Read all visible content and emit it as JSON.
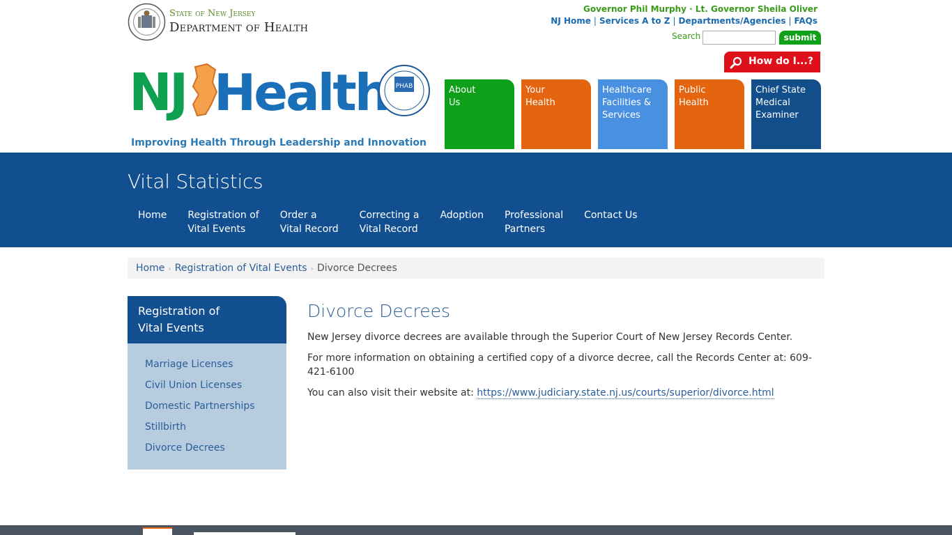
{
  "header": {
    "state_line": "State of New Jersey",
    "dept_line": "Department of Health",
    "gov_line": "Governor Phil Murphy · Lt. Governor Sheila Oliver",
    "top_links": [
      "NJ Home",
      "Services A to Z",
      "Departments/Agencies",
      "FAQs"
    ],
    "search_label": "Search",
    "search_value": "",
    "search_button": "submit",
    "howdo_label": "How do I...?",
    "tagline": "Improving Health Through Leadership and Innovation",
    "tiles": [
      "About\nUs",
      "Your\nHealth",
      "Healthcare\nFacilities &\nServices",
      "Public\nHealth",
      "Chief State\nMedical\nExaminer"
    ]
  },
  "band": {
    "title": "Vital Statistics",
    "nav": [
      "Home",
      "Registration of\nVital Events",
      "Order a\nVital Record",
      "Correcting a\nVital Record",
      "Adoption",
      "Professional\nPartners",
      "Contact Us"
    ]
  },
  "breadcrumb": {
    "items": [
      "Home",
      "Registration of Vital Events"
    ],
    "current": "Divorce Decrees"
  },
  "sidebar": {
    "heading": "Registration of\nVital Events",
    "items": [
      "Marriage Licenses",
      "Civil Union Licenses",
      "Domestic Partnerships",
      "Stillbirth",
      "Divorce Decrees"
    ]
  },
  "main": {
    "title": "Divorce Decrees",
    "p1": "New Jersey divorce decrees are available through the Superior Court of New Jersey Records Center.",
    "p2": "For more information on obtaining a certified copy of a divorce decree, call the Records Center at: 609-421-6100",
    "p3_prefix": "You can also visit their website at: ",
    "p3_link": "https://www.judiciary.state.nj.us/courts/superior/divorce.html"
  },
  "logo": {
    "text_nj": "NJ",
    "text_health": "Health",
    "phab": "PHAB"
  },
  "colors": {
    "brand_blue": "#124f90",
    "green": "#0fa01a",
    "orange": "#e5640f",
    "light_blue": "#4a90e0",
    "red": "#e0101a"
  }
}
